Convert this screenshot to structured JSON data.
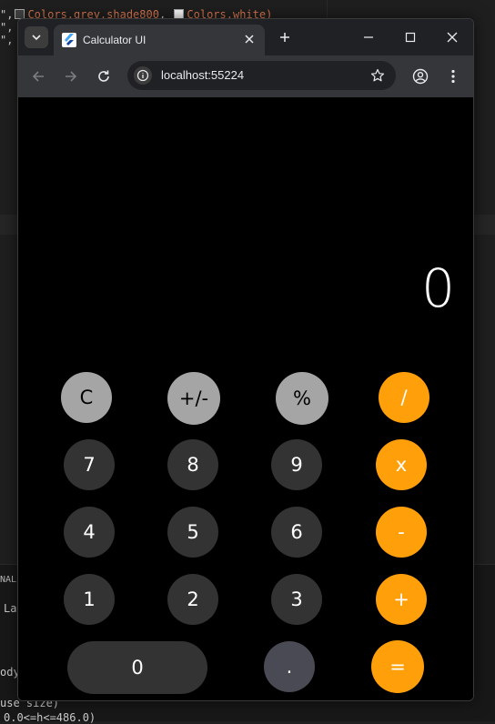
{
  "editor": {
    "line1": {
      "a": "Colors.grey.shade800",
      "sep": ", ",
      "b": "Colors.white)"
    },
    "line2_prefix": "\",",
    "line3_prefix": "\","
  },
  "panel": {
    "tab_label": "NAL",
    "line1": "La",
    "line2": "ody",
    "line3": "use size)",
    "line4": "0.0<=h<=486.0)"
  },
  "browser": {
    "tab_title": "Calculator UI",
    "url": "localhost:55224"
  },
  "calculator": {
    "display": "0",
    "colors": {
      "light": "#a5a5a5",
      "dark": "#333333",
      "orange": "#ff9f0a"
    },
    "keys": [
      [
        "C",
        "+/-",
        "%",
        "/"
      ],
      [
        "7",
        "8",
        "9",
        "x"
      ],
      [
        "4",
        "5",
        "6",
        "-"
      ],
      [
        "1",
        "2",
        "3",
        "+"
      ],
      [
        "0",
        ".",
        "="
      ]
    ]
  }
}
